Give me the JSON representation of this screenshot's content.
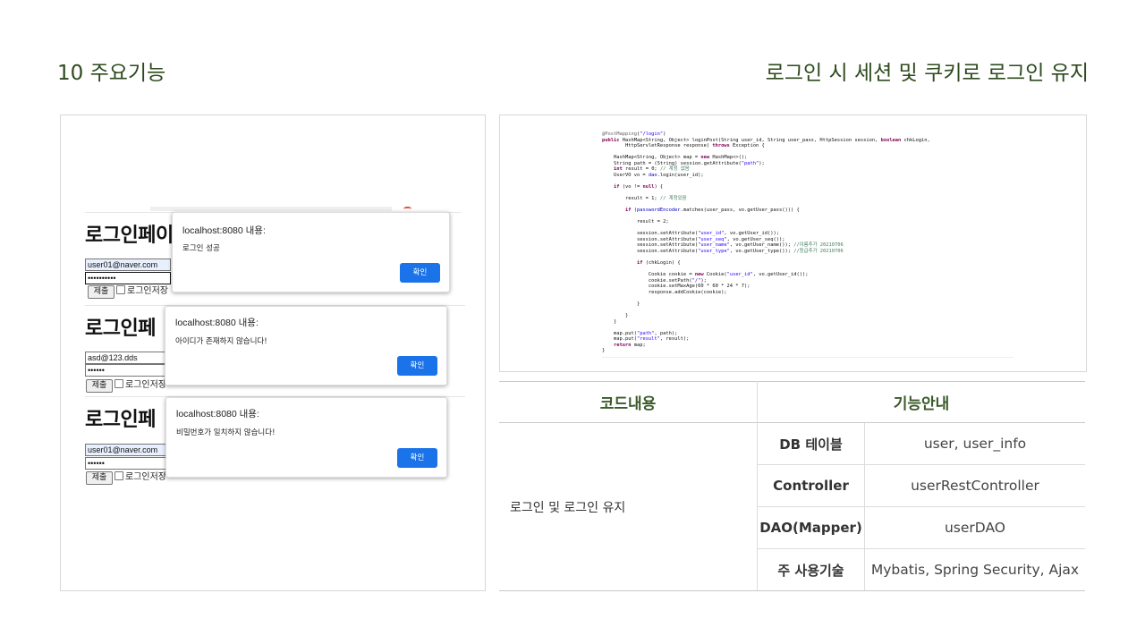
{
  "slide": {
    "number": "10 주요기능",
    "title": "로그인 시 세션 및 쿠키로 로그인 유지"
  },
  "screenshots": [
    {
      "heading": "로그인페이",
      "id_value": "user01@naver.com",
      "pw_value": "••••••••••",
      "submit_label": "제출",
      "remember_label": "로그인저장",
      "dialog": {
        "origin": "localhost:8080 내용:",
        "message": "로그인 성공",
        "ok": "확인"
      }
    },
    {
      "heading": "로그인페",
      "id_value": "asd@123.dds",
      "pw_value": "••••••",
      "submit_label": "제출",
      "remember_label": "로그인저장",
      "dialog": {
        "origin": "localhost:8080 내용:",
        "message": "아이디가 존재하지 않습니다!",
        "ok": "확인"
      }
    },
    {
      "heading": "로그인페",
      "id_value": "user01@naver.com",
      "pw_value": "••••••",
      "submit_label": "제출",
      "remember_label": "로그인저장",
      "dialog": {
        "origin": "localhost:8080 내용:",
        "message": "비밀번호가 일치하지 않습니다!",
        "ok": "확인"
      }
    }
  ],
  "code": [
    "@PostMapping(\"/login\")",
    "public HashMap<String, Object> loginPost(String user_id, String user_pass, HttpSession session, boolean chkLogin,",
    "        HttpServletResponse response) throws Exception {",
    "",
    "    HashMap<String, Object> map = new HashMap<>();",
    "    String path = (String) session.getAttribute(\"path\");",
    "    int result = 0; // 계정 없음",
    "    UserVO vo = dao.login(user_id);",
    "",
    "    if (vo != null) {",
    "",
    "        result = 1; // 계정있음",
    "",
    "        if (passwordEncoder.matches(user_pass, vo.getUser_pass())) {",
    "",
    "            result = 2;",
    "",
    "            session.setAttribute(\"user_id\", vo.getUser_id());",
    "            session.setAttribute(\"user_seq\", vo.getUser_seq());",
    "            session.setAttribute(\"user_name\", vo.getUser_name()); //이름추가 20210706",
    "            session.setAttribute(\"user_type\", vo.getUser_type()); //등급추가 20210706",
    "",
    "            if (chkLogin) {",
    "",
    "                Cookie cookie = new Cookie(\"user_id\", vo.getUser_id());",
    "                cookie.setPath(\"/\");",
    "                cookie.setMaxAge(60 * 60 * 24 * 7);",
    "                response.addCookie(cookie);",
    "",
    "            }",
    "",
    "        }",
    "    }",
    "",
    "    map.put(\"path\", path);",
    "    map.put(\"result\", result);",
    "    return map;",
    "}"
  ],
  "table": {
    "col1_header": "코드내용",
    "col2_header": "기능안내",
    "description": "로그인 및 로그인 유지",
    "rows": [
      {
        "label": "DB 테이블",
        "value": "user, user_info"
      },
      {
        "label": "Controller",
        "value": "userRestController"
      },
      {
        "label": "DAO(Mapper)",
        "value": "userDAO"
      },
      {
        "label": "주 사용기술",
        "value": "Mybatis, Spring Security, Ajax"
      }
    ]
  },
  "colors": {
    "title_green": "#2e4a1e",
    "header_green": "#3a5a2a",
    "dialog_button": "#1a73e8"
  }
}
